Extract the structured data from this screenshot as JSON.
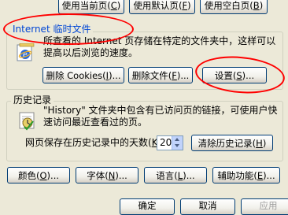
{
  "home": {
    "use_current": "使用当前页",
    "use_current_key": "C",
    "use_default": "使用默认页",
    "use_default_key": "F",
    "use_blank": "使用空白页",
    "use_blank_key": "B"
  },
  "temp_files": {
    "title": "Internet 临时文件",
    "desc_line1": "所查看的 Internet 页存储在特定的文件夹中，这样可以",
    "desc_line2": "提高以后浏览的速度。",
    "delete_cookies": "删除 Cookies",
    "delete_cookies_key": "I",
    "delete_files": "删除文件",
    "delete_files_key": "F",
    "settings": "设置",
    "settings_key": "S",
    "ellipsis": "..."
  },
  "history": {
    "title": "历史记录",
    "desc_line1": "\"History\" 文件夹中包含有已访问页的链接，可使用户快",
    "desc_line2": "速访问最近查看过的页。",
    "days_label": "网页保存在历史记录中的天数",
    "days_key": "K",
    "days_value": "20",
    "clear_label": "清除历史记录",
    "clear_key": "H"
  },
  "bottom": {
    "colors": "颜色",
    "colors_key": "O",
    "fonts": "字体",
    "fonts_key": "N",
    "languages": "语言",
    "languages_key": "L",
    "accessibility": "辅助功能",
    "accessibility_key": "E"
  },
  "dialog": {
    "ok": "确定",
    "cancel": "取消",
    "apply": "应用"
  },
  "colors": {
    "annotation": "#ff0000",
    "button_border": "#003c74",
    "title_blue": "#0046d5"
  }
}
